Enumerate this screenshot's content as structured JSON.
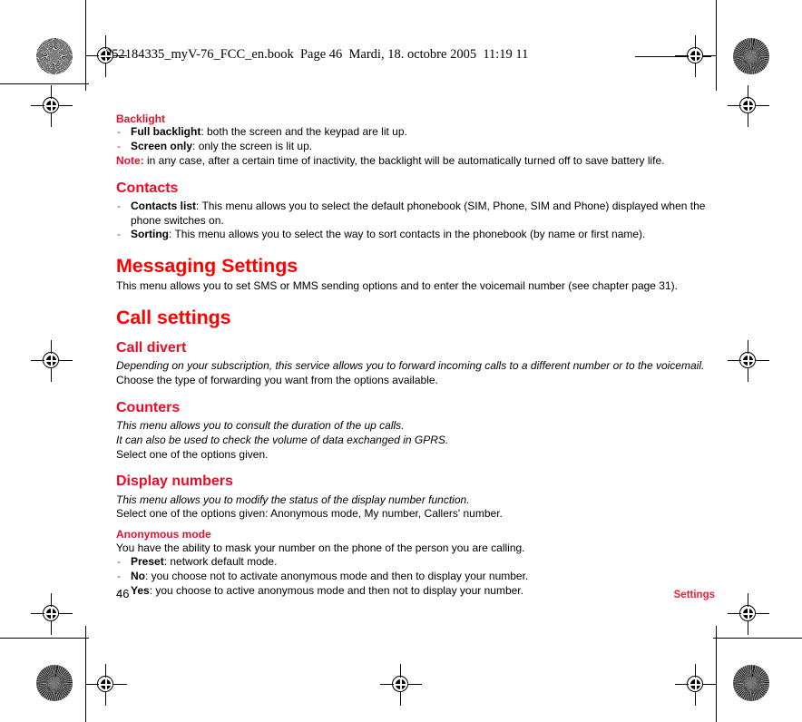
{
  "header": {
    "slug": "252184335_myV-76_FCC_en.book  Page 46  Mardi, 18. octobre 2005  11:19 11"
  },
  "colors": {
    "heading_red": "#ff0000",
    "subheading_red": "#e8112d",
    "body_black": "#000000"
  },
  "sections": {
    "backlight": {
      "heading": "Backlight",
      "items": [
        {
          "term": "Full backlight",
          "rest": ": both the screen and the keypad are lit up."
        },
        {
          "term": "Screen only",
          "rest": ": only the screen is lit up."
        }
      ],
      "note_label": "Note:",
      "note_text": " in any case, after a certain time of inactivity, the backlight will be automatically turned off to save battery life."
    },
    "contacts": {
      "heading": "Contacts",
      "items": [
        {
          "term": "Contacts list",
          "rest": ": This menu allows you to select the default phonebook (SIM, Phone, SIM and Phone) displayed when the phone switches on."
        },
        {
          "term": "Sorting",
          "rest": ": This menu allows you to select the way to sort contacts in the phonebook (by name or first name)."
        }
      ]
    },
    "messaging_settings": {
      "heading": "Messaging Settings",
      "paragraph": "This menu allows you to set SMS or MMS sending options and to enter the voicemail number (see chapter page 31)."
    },
    "call_settings": {
      "heading": "Call settings"
    },
    "call_divert": {
      "heading": "Call divert",
      "italic_line": "Depending on your subscription, this service allows you to forward incoming calls to a different number or to the voicemail.",
      "paragraph": "Choose the type of forwarding you want from the options available."
    },
    "counters": {
      "heading": "Counters",
      "italic_line_1": "This menu allows you to consult the duration of the up calls.",
      "italic_line_2": "It can also be used to check the volume of data exchanged in GPRS.",
      "paragraph": "Select one of the options given."
    },
    "display_numbers": {
      "heading": "Display numbers",
      "italic_line": "This menu allows you to modify the status of the display number function.",
      "paragraph": "Select one of the options given: Anonymous mode, My number, Callers' number.",
      "subheading": "Anonymous mode",
      "intro": "You have the ability to mask your number on the phone of the person you are calling.",
      "items": [
        {
          "term": "Preset",
          "rest": ": network default mode."
        },
        {
          "term": "No",
          "rest": ": you choose not to activate anonymous mode and then to display your number."
        },
        {
          "term": "Yes",
          "rest": ": you choose to active anonymous mode and then not to display your number."
        }
      ]
    }
  },
  "footer": {
    "page_number": "46",
    "running_head": "Settings"
  }
}
